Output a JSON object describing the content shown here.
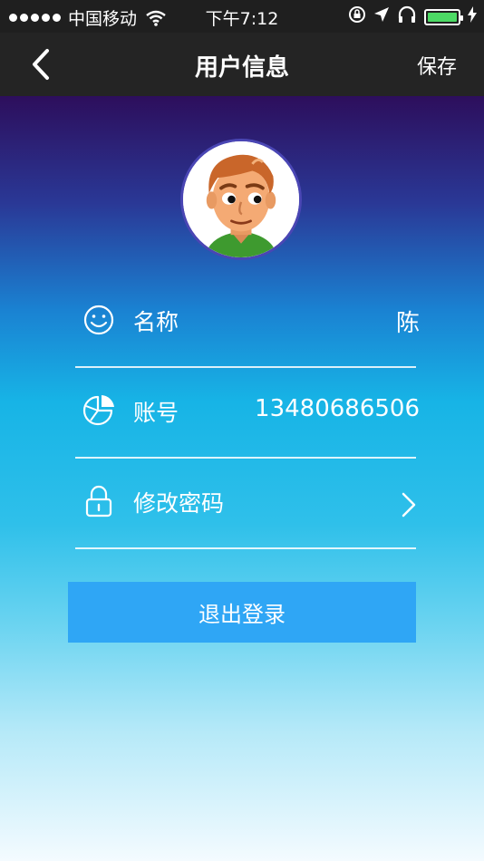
{
  "status_bar": {
    "carrier": "中国移动",
    "time": "下午7:12",
    "battery_level": 1.0,
    "battery_color": "#4cd964"
  },
  "nav": {
    "title": "用户信息",
    "save_label": "保存",
    "back_icon": "chevron-left-icon"
  },
  "profile": {
    "avatar": "avatar-cartoon-man"
  },
  "rows": [
    {
      "icon": "smile-icon",
      "label": "名称",
      "value": "陈"
    },
    {
      "icon": "pie-chart-icon",
      "label": "账号",
      "value": "13480686506"
    },
    {
      "icon": "lock-icon",
      "label": "修改密码",
      "value": ""
    }
  ],
  "logout_label": "退出登录",
  "colors": {
    "logout_button": "#2fa6f5",
    "nav_bg": "#242424"
  }
}
